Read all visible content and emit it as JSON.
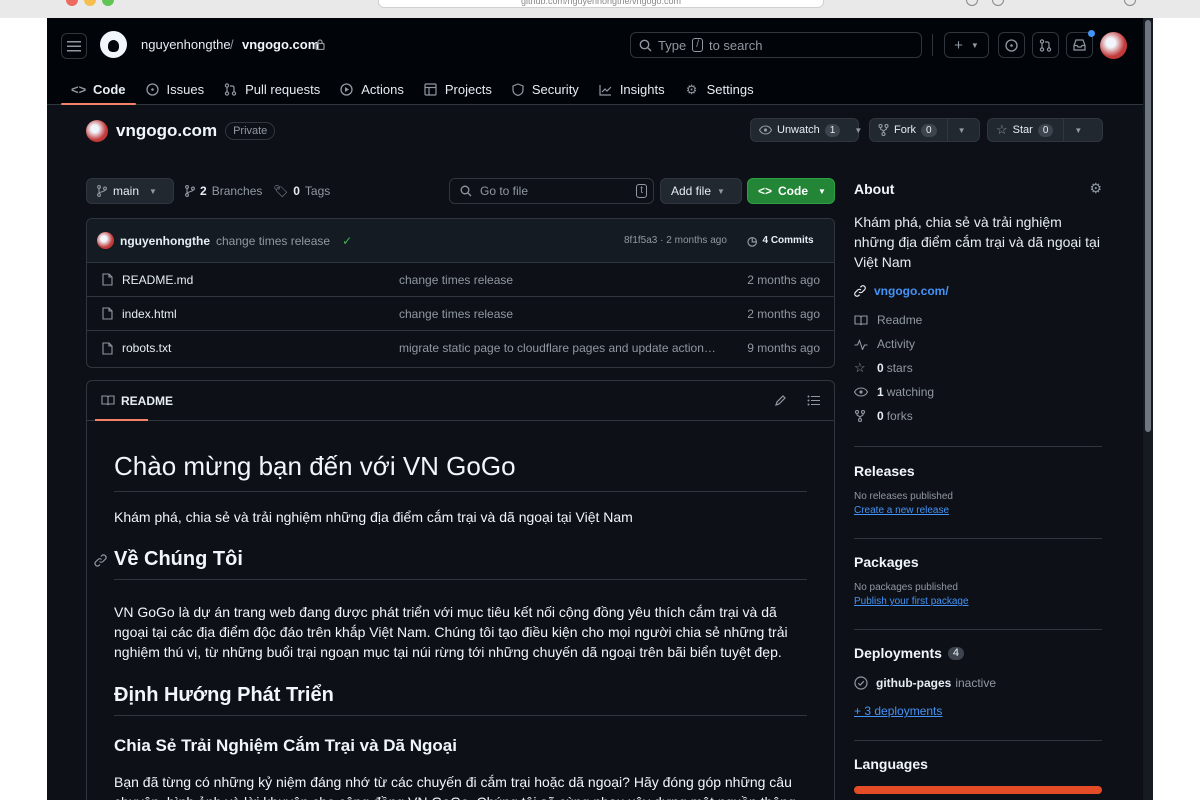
{
  "browser": {
    "url": "github.com/nguyenhongthe/vngogo.com"
  },
  "header": {
    "owner": "nguyenhongthe",
    "separator": "/",
    "repo": "vngogo.com",
    "search_text_before": "Type",
    "search_key": "/",
    "search_text_after": "to search",
    "plus_label": "+"
  },
  "tabs": [
    {
      "label": "Code",
      "icon": "code-icon"
    },
    {
      "label": "Issues",
      "icon": "issue-icon"
    },
    {
      "label": "Pull requests",
      "icon": "pull-request-icon"
    },
    {
      "label": "Actions",
      "icon": "play-icon"
    },
    {
      "label": "Projects",
      "icon": "table-icon"
    },
    {
      "label": "Security",
      "icon": "shield-icon"
    },
    {
      "label": "Insights",
      "icon": "graph-icon"
    },
    {
      "label": "Settings",
      "icon": "gear-icon"
    }
  ],
  "repo": {
    "name": "vngogo.com",
    "visibility": "Private",
    "unwatch_label": "Unwatch",
    "unwatch_count": "1",
    "fork_label": "Fork",
    "fork_count": "0",
    "star_label": "Star",
    "star_count": "0"
  },
  "toolbar": {
    "branch": "main",
    "branches_count": "2",
    "branches_label": "Branches",
    "tags_count": "0",
    "tags_label": "Tags",
    "go_to_file": "Go to file",
    "go_to_file_key": "t",
    "add_file": "Add file",
    "code": "Code"
  },
  "commit": {
    "author": "nguyenhongthe",
    "message": "change times release",
    "hash": "8f1f5a3",
    "dot": "·",
    "time": "2 months ago",
    "commits_label": "4 Commits"
  },
  "files": [
    {
      "name": "README.md",
      "message": "change times release",
      "date": "2 months ago"
    },
    {
      "name": "index.html",
      "message": "change times release",
      "date": "2 months ago"
    },
    {
      "name": "robots.txt",
      "message": "migrate static page to cloudflare pages and update action…",
      "date": "9 months ago"
    }
  ],
  "readme": {
    "tab_label": "README",
    "h1": "Chào mừng bạn đến với VN GoGo",
    "intro": "Khám phá, chia sẻ và trải nghiệm những địa điểm cắm trại và dã ngoại tại Việt Nam",
    "h2_about": "Về Chúng Tôi",
    "about_text": "VN GoGo là dự án trang web đang được phát triển với mục tiêu kết nối cộng đồng yêu thích cắm trại và dã ngoại tại các địa điểm độc đáo trên khắp Việt Nam. Chúng tôi tạo điều kiện cho mọi người chia sẻ những trải nghiệm thú vị, từ những buổi trại ngoạn mục tại núi rừng tới những chuyến dã ngoại trên bãi biển tuyệt đẹp.",
    "h2_direction": "Định Hướng Phát Triển",
    "h3_share": "Chia Sẻ Trải Nghiệm Cắm Trại và Dã Ngoại",
    "share_text": "Bạn đã từng có những kỷ niệm đáng nhớ từ các chuyến đi cắm trại hoặc dã ngoại? Hãy đóng góp những câu chuyện, hình ảnh và lời khuyên cho cộng đồng VN GoGo. Chúng tôi sẽ cùng nhau xây dựng một nguồn thông tin"
  },
  "about": {
    "title": "About",
    "description": "Khám phá, chia sẻ và trải nghiệm những địa điểm cắm trại và dã ngoại tại Việt Nam",
    "website": "vngogo.com/",
    "readme": "Readme",
    "activity": "Activity",
    "stars_count": "0",
    "stars_label": "stars",
    "watching_count": "1",
    "watching_label": "watching",
    "forks_count": "0",
    "forks_label": "forks"
  },
  "releases": {
    "title": "Releases",
    "empty": "No releases published",
    "create": "Create a new release"
  },
  "packages": {
    "title": "Packages",
    "empty": "No packages published",
    "publish": "Publish your first package"
  },
  "deployments": {
    "title": "Deployments",
    "count": "4",
    "env": "github-pages",
    "status": "inactive",
    "more": "+ 3 deployments"
  },
  "languages": {
    "title": "Languages"
  },
  "colors": {
    "bg": "#0d1117",
    "accent": "#f78166",
    "link": "#4493f8",
    "green": "#238636"
  }
}
